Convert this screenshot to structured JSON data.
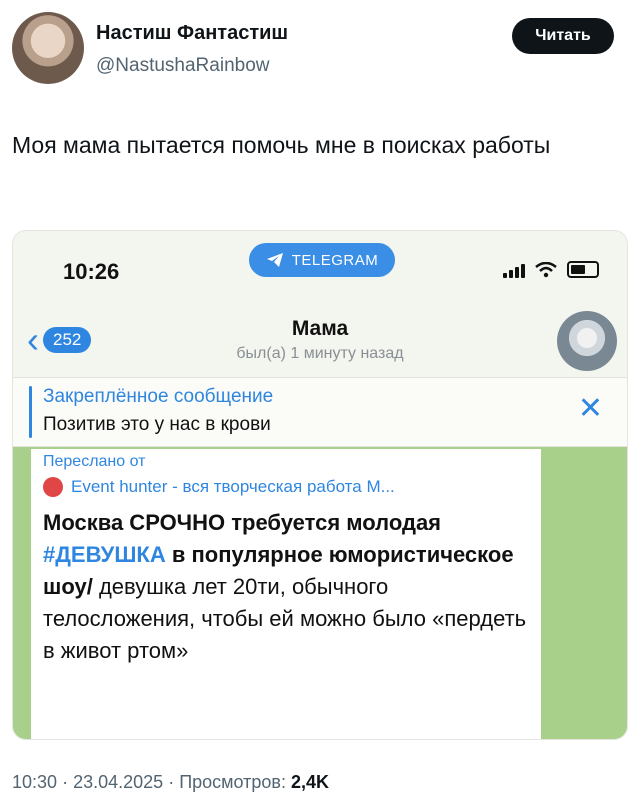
{
  "tweet": {
    "author_name": "Настиш Фантастиш",
    "author_handle": "@NastushaRainbow",
    "follow_label": "Читать",
    "text": "Моя мама пытается помочь мне в поисках работы",
    "time": "10:30",
    "date": "23.04.2025",
    "views_label": "Просмотров:",
    "views_value": "2,4K",
    "separator": "·"
  },
  "phone": {
    "status_time": "10:26",
    "app_pill": "TELEGRAM",
    "back_count": "252",
    "chat_title": "Мама",
    "chat_status": "был(а) 1 минуту назад",
    "pinned_title": "Закреплённое сообщение",
    "pinned_text": "Позитив это у нас в крови",
    "close_glyph": "✕",
    "back_glyph": "‹",
    "forwarded_label": "Переслано от",
    "forwarded_source": "Event hunter - вся творческая работа М...",
    "message_bold": "Москва СРОЧНО требуется молодая",
    "message_hashtag": "#ДЕВУШКА",
    "message_bold_2": "в популярное юмористическое шоу/",
    "message_body": "девушка лет 20ти, обычного телосложения, чтобы ей можно было «пердеть в живот ртом»"
  },
  "colors": {
    "accent_blue": "#2f86e0",
    "chat_bg": "#a8d08a",
    "follow_btn_bg": "#0f1419"
  },
  "icons": [
    "telegram-plane-icon",
    "signal-icon",
    "wifi-icon",
    "battery-icon",
    "close-icon",
    "back-chevron-icon"
  ]
}
